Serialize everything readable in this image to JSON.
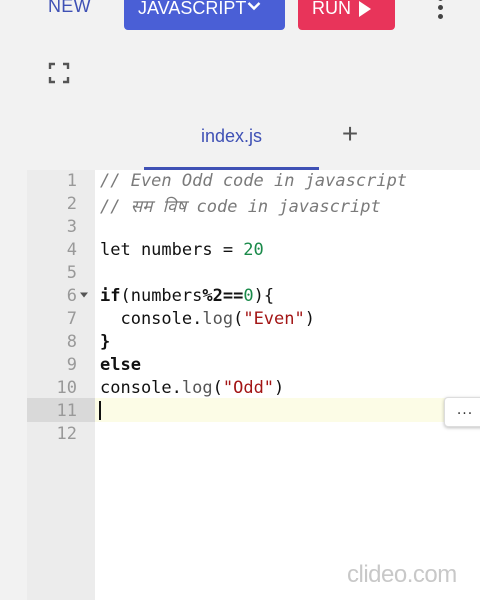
{
  "toolbar": {
    "new_label": "NEW",
    "language_label": "JAVASCRIPT",
    "run_label": "RUN"
  },
  "tabs": {
    "active_tab": "index.js",
    "add_label": "+"
  },
  "editor": {
    "lines": [
      {
        "n": "1"
      },
      {
        "n": "2"
      },
      {
        "n": "3"
      },
      {
        "n": "4"
      },
      {
        "n": "5"
      },
      {
        "n": "6"
      },
      {
        "n": "7"
      },
      {
        "n": "8"
      },
      {
        "n": "9"
      },
      {
        "n": "10"
      },
      {
        "n": "11"
      },
      {
        "n": "12"
      }
    ],
    "code": {
      "l1": "// Even Odd code in javascript",
      "l2": "// सम विष code in javascript",
      "l4_a": "let numbers = ",
      "l4_num": "20",
      "l6_kw": "if",
      "l6_a": "(numbers",
      "l6_op": "%2==",
      "l6_num": "0",
      "l6_b": "){",
      "l7_a": "  console.",
      "l7_fn": "log",
      "l7_b": "(",
      "l7_str": "\"Even\"",
      "l7_c": ")",
      "l8": "}",
      "l9": "else",
      "l10_a": "console.",
      "l10_fn": "log",
      "l10_b": "(",
      "l10_str": "\"Odd\"",
      "l10_c": ")"
    },
    "active_line": 11,
    "more_label": "..."
  },
  "watermark": "clideo.com",
  "icons": {
    "language_dropdown": "chevron-down-icon",
    "run": "play-icon",
    "more": "more-vertical-icon",
    "expand": "fullscreen-icon",
    "fold": "fold-arrow-icon"
  },
  "colors": {
    "accent": "#3f51b5",
    "language_button": "#4a5fd6",
    "run_button": "#e8345a"
  }
}
